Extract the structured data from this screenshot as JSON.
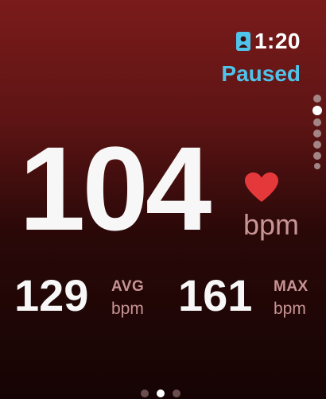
{
  "status": {
    "time": "1:20",
    "state": "Paused",
    "icon": "workout-badge-icon"
  },
  "heart_rate": {
    "value": "104",
    "unit": "bpm",
    "icon": "heart-icon"
  },
  "average": {
    "value": "129",
    "label": "AVG",
    "unit": "bpm"
  },
  "maximum": {
    "value": "161",
    "label": "MAX",
    "unit": "bpm"
  },
  "scroll_indicator": {
    "count": 7,
    "active_index": 1
  },
  "page_indicator": {
    "count": 3,
    "active_index": 1
  },
  "colors": {
    "accent": "#4fc3ea",
    "heart": "#e5383b",
    "muted": "#c89494"
  }
}
